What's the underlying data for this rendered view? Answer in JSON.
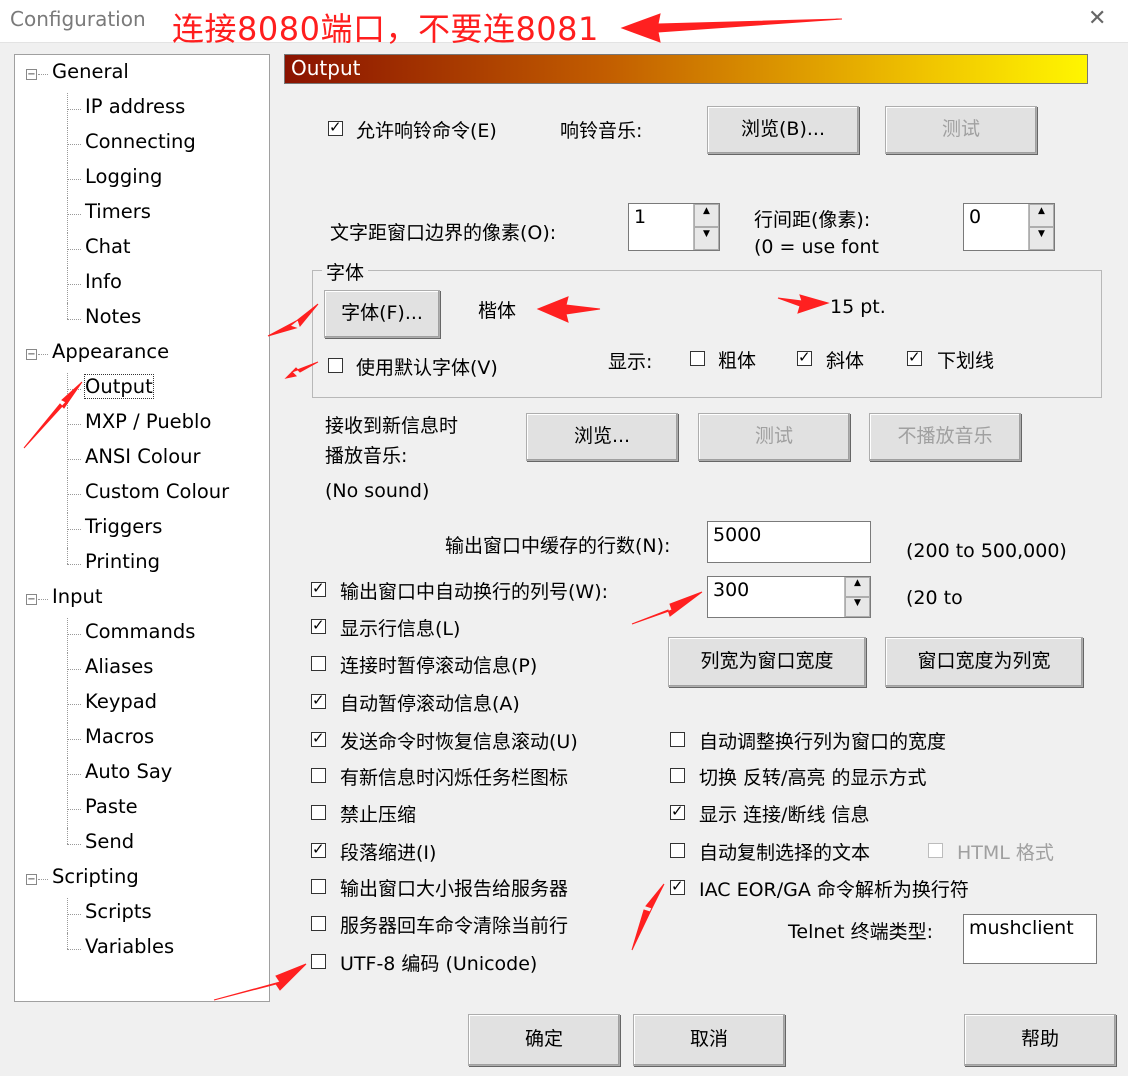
{
  "window": {
    "title": "Configuration",
    "annotation": "连接8080端口，不要连8081",
    "close_glyph": "✕"
  },
  "tree": [
    {
      "label": "General",
      "level": 0
    },
    {
      "label": "IP address",
      "level": 1
    },
    {
      "label": "Connecting",
      "level": 1
    },
    {
      "label": "Logging",
      "level": 1
    },
    {
      "label": "Timers",
      "level": 1
    },
    {
      "label": "Chat",
      "level": 1
    },
    {
      "label": "Info",
      "level": 1
    },
    {
      "label": "Notes",
      "level": 1
    },
    {
      "label": "Appearance",
      "level": 0
    },
    {
      "label": "Output",
      "level": 1
    },
    {
      "label": "MXP / Pueblo",
      "level": 1
    },
    {
      "label": "ANSI Colour",
      "level": 1
    },
    {
      "label": "Custom Colour",
      "level": 1
    },
    {
      "label": "Triggers",
      "level": 1
    },
    {
      "label": "Printing",
      "level": 1
    },
    {
      "label": "Input",
      "level": 0
    },
    {
      "label": "Commands",
      "level": 1
    },
    {
      "label": "Aliases",
      "level": 1
    },
    {
      "label": "Keypad",
      "level": 1
    },
    {
      "label": "Macros",
      "level": 1
    },
    {
      "label": "Auto Say",
      "level": 1
    },
    {
      "label": "Paste",
      "level": 1
    },
    {
      "label": "Send",
      "level": 1
    },
    {
      "label": "Scripting",
      "level": 0
    },
    {
      "label": "Scripts",
      "level": 1
    },
    {
      "label": "Variables",
      "level": 1
    }
  ],
  "panel": {
    "title": "Output",
    "bell": {
      "checkbox": "允许响铃命令(E)",
      "sound_label": "响铃音乐:",
      "browse": "浏览(B)...",
      "test": "测试"
    },
    "pixels": {
      "label": "文字距窗口边界的像素(O):",
      "value": "1"
    },
    "line_spacing": {
      "label1": "行间距(像素):",
      "label2": "(0 = use font",
      "value": "0"
    },
    "font_group": {
      "title": "字体",
      "font_button": "字体(F)...",
      "font_name": "楷体",
      "font_size": "15 pt.",
      "use_default": "使用默认字体(V)",
      "show_label": "显示:",
      "bold": "粗体",
      "italic": "斜体",
      "underline": "下划线"
    },
    "new_info": {
      "label1": "接收到新信息时",
      "label2": "播放音乐:",
      "browse": "浏览...",
      "test": "测试",
      "no_play": "不播放音乐",
      "sound": "(No sound)"
    },
    "buffer": {
      "label": "输出窗口中缓存的行数(N):",
      "value": "5000",
      "range": "(200 to 500,000)"
    },
    "wrap": {
      "label": "输出窗口中自动换行的列号(W):",
      "value": "300",
      "range": "(20 to"
    },
    "btn_col_to_win": "列宽为窗口宽度",
    "btn_win_to_col": "窗口宽度为列宽",
    "left_options": [
      {
        "label": "显示行信息(L)",
        "checked": true
      },
      {
        "label": "连接时暂停滚动信息(P)",
        "checked": false
      },
      {
        "label": "自动暂停滚动信息(A)",
        "checked": true
      },
      {
        "label": "发送命令时恢复信息滚动(U)",
        "checked": true
      },
      {
        "label": "有新信息时闪烁任务栏图标",
        "checked": false
      },
      {
        "label": "禁止压缩",
        "checked": false
      },
      {
        "label": "段落缩进(I)",
        "checked": true
      },
      {
        "label": "输出窗口大小报告给服务器",
        "checked": false
      },
      {
        "label": "服务器回车命令清除当前行",
        "checked": false
      },
      {
        "label": "UTF-8 编码 (Unicode)",
        "checked": false
      }
    ],
    "right_options": [
      {
        "label": "自动调整换行列为窗口的宽度",
        "checked": false
      },
      {
        "label": "切换 反转/高亮 的显示方式",
        "checked": false
      },
      {
        "label": "显示 连接/断线 信息",
        "checked": true
      },
      {
        "label": "自动复制选择的文本",
        "checked": false
      },
      {
        "label": "IAC EOR/GA 命令解析为换行符",
        "checked": true
      }
    ],
    "html_format": "HTML 格式",
    "telnet": {
      "label": "Telnet 终端类型:",
      "value": "mushclient"
    }
  },
  "footer": {
    "ok": "确定",
    "cancel": "取消",
    "help": "帮助"
  },
  "colors": {
    "annotation": "#ff1e1e",
    "banner_start": "#8a1200",
    "banner_end": "#fff600"
  }
}
